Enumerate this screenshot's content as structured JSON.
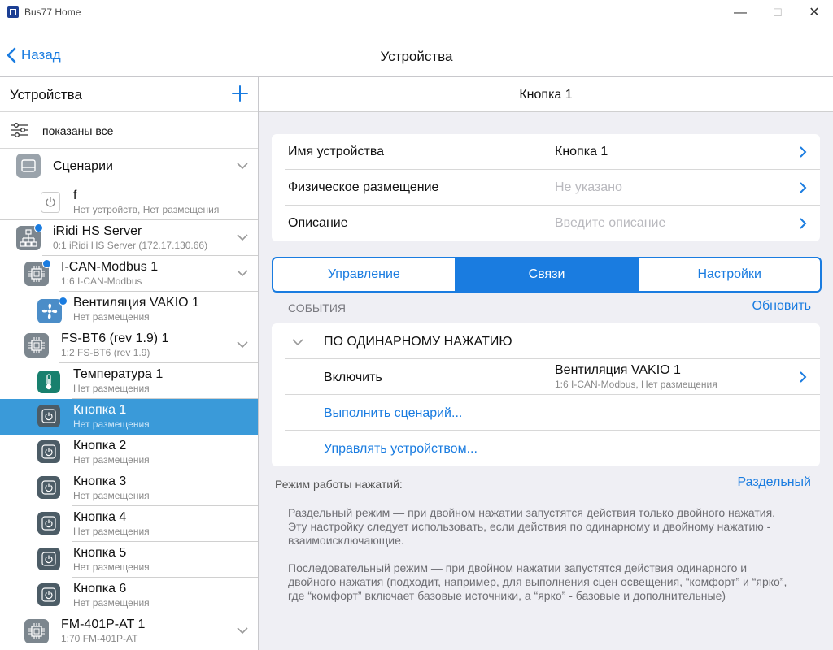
{
  "window": {
    "title": "Bus77 Home",
    "controls": {
      "minimize": "—",
      "maximize": "☐",
      "close": "✕"
    }
  },
  "navbar": {
    "back_label": "Назад",
    "title": "Устройства"
  },
  "sidebar": {
    "title": "Устройства",
    "add_icon": "plus-icon",
    "filter_label": "показаны все",
    "items": [
      {
        "name": "Сценарии",
        "sub": "",
        "icon": "folder-icon",
        "expandable": true
      },
      {
        "name": "f",
        "sub": "Нет устройств, Нет размещения",
        "icon": "power-icon"
      },
      {
        "name": "iRidi HS Server",
        "sub": "0:1 iRidi HS Server (172.17.130.66)",
        "icon": "network-icon",
        "expandable": true,
        "status": "online"
      },
      {
        "name": "I-CAN-Modbus 1",
        "sub": "1:6 I-CAN-Modbus",
        "icon": "chip-icon",
        "expandable": true,
        "status": "online"
      },
      {
        "name": "Вентиляция VAKIO 1",
        "sub": "Нет размещения",
        "icon": "fan-icon",
        "status": "online"
      },
      {
        "name": "FS-BT6 (rev 1.9) 1",
        "sub": "1:2 FS-BT6 (rev 1.9)",
        "icon": "chip-icon",
        "expandable": true
      },
      {
        "name": "Температура 1",
        "sub": "Нет размещения",
        "icon": "thermometer-icon"
      },
      {
        "name": "Кнопка 1",
        "sub": "Нет размещения",
        "icon": "power-icon",
        "selected": true
      },
      {
        "name": "Кнопка 2",
        "sub": "Нет размещения",
        "icon": "power-icon"
      },
      {
        "name": "Кнопка 3",
        "sub": "Нет размещения",
        "icon": "power-icon"
      },
      {
        "name": "Кнопка 4",
        "sub": "Нет размещения",
        "icon": "power-icon"
      },
      {
        "name": "Кнопка 5",
        "sub": "Нет размещения",
        "icon": "power-icon"
      },
      {
        "name": "Кнопка 6",
        "sub": "Нет размещения",
        "icon": "power-icon"
      },
      {
        "name": "FM-401P-AT 1",
        "sub": "1:70 FM-401P-AT",
        "icon": "chip-icon",
        "expandable": true
      }
    ]
  },
  "detail": {
    "title": "Кнопка 1",
    "fields": [
      {
        "label": "Имя устройства",
        "value": "Кнопка 1",
        "placeholder": false
      },
      {
        "label": "Физическое размещение",
        "value": "Не указано",
        "placeholder": true
      },
      {
        "label": "Описание",
        "value": "Введите описание",
        "placeholder": true
      }
    ],
    "tabs": [
      {
        "label": "Управление",
        "active": false
      },
      {
        "label": "Связи",
        "active": true
      },
      {
        "label": "Настройки",
        "active": false
      }
    ],
    "events_label": "СОБЫТИЯ",
    "refresh_label": "Обновить",
    "event_group": "ПО ОДИНАРНОМУ НАЖАТИЮ",
    "action": {
      "label": "Включить",
      "target_name": "Вентиляция VAKIO 1",
      "target_sub": "1:6 I-CAN-Modbus, Нет размещения"
    },
    "run_scenario": "Выполнить сценарий...",
    "control_device": "Управлять устройством...",
    "mode_label": "Режим работы нажатий:",
    "mode_value": "Раздельный",
    "help_1": "Раздельный режим — при двойном нажатии запустятся действия только двойного нажатия. Эту настройку следует использовать, если действия по одинарному и двойному нажатию - взаимоисключающие.",
    "help_2": "Последовательный режим — при двойном нажатии запустятся действия одинарного и двойного нажатия (подходит, например, для выполнения сцен освещения, “комфорт” и “ярко”, где “комфорт” включает базовые источники, а “ярко” - базовые и дополнительные)"
  },
  "colors": {
    "accent": "#1a7ce0",
    "selected_row": "#3a9ad9",
    "background": "#efeff4"
  }
}
